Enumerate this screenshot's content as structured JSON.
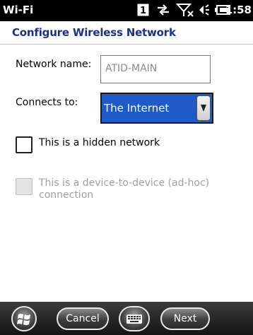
{
  "status_bar": {
    "app_title": "Wi-Fi",
    "time": "1:58",
    "icons": [
      "notification-count-icon",
      "data-connection-icon",
      "no-signal-icon",
      "volume-icon",
      "battery-icon"
    ],
    "notification_count": "1"
  },
  "header": {
    "title": "Configure Wireless Network"
  },
  "form": {
    "network_name_label": "Network name:",
    "network_name_value": "ATID-MAIN",
    "connects_to_label": "Connects to:",
    "connects_to_value": "The Internet",
    "hidden_network_label": "This is a hidden network",
    "hidden_network_checked": false,
    "adhoc_label_line1": "This is a device-to-device (ad-hoc)",
    "adhoc_label_line2": "connection",
    "adhoc_checked": false,
    "adhoc_enabled": false
  },
  "bottom_bar": {
    "start_icon": "windows-start-icon",
    "cancel_label": "Cancel",
    "keyboard_icon": "keyboard-icon",
    "next_label": "Next"
  },
  "colors": {
    "header_text": "#1c2f8a",
    "selection": "#1f5ac9",
    "status_bar": "#000000"
  }
}
